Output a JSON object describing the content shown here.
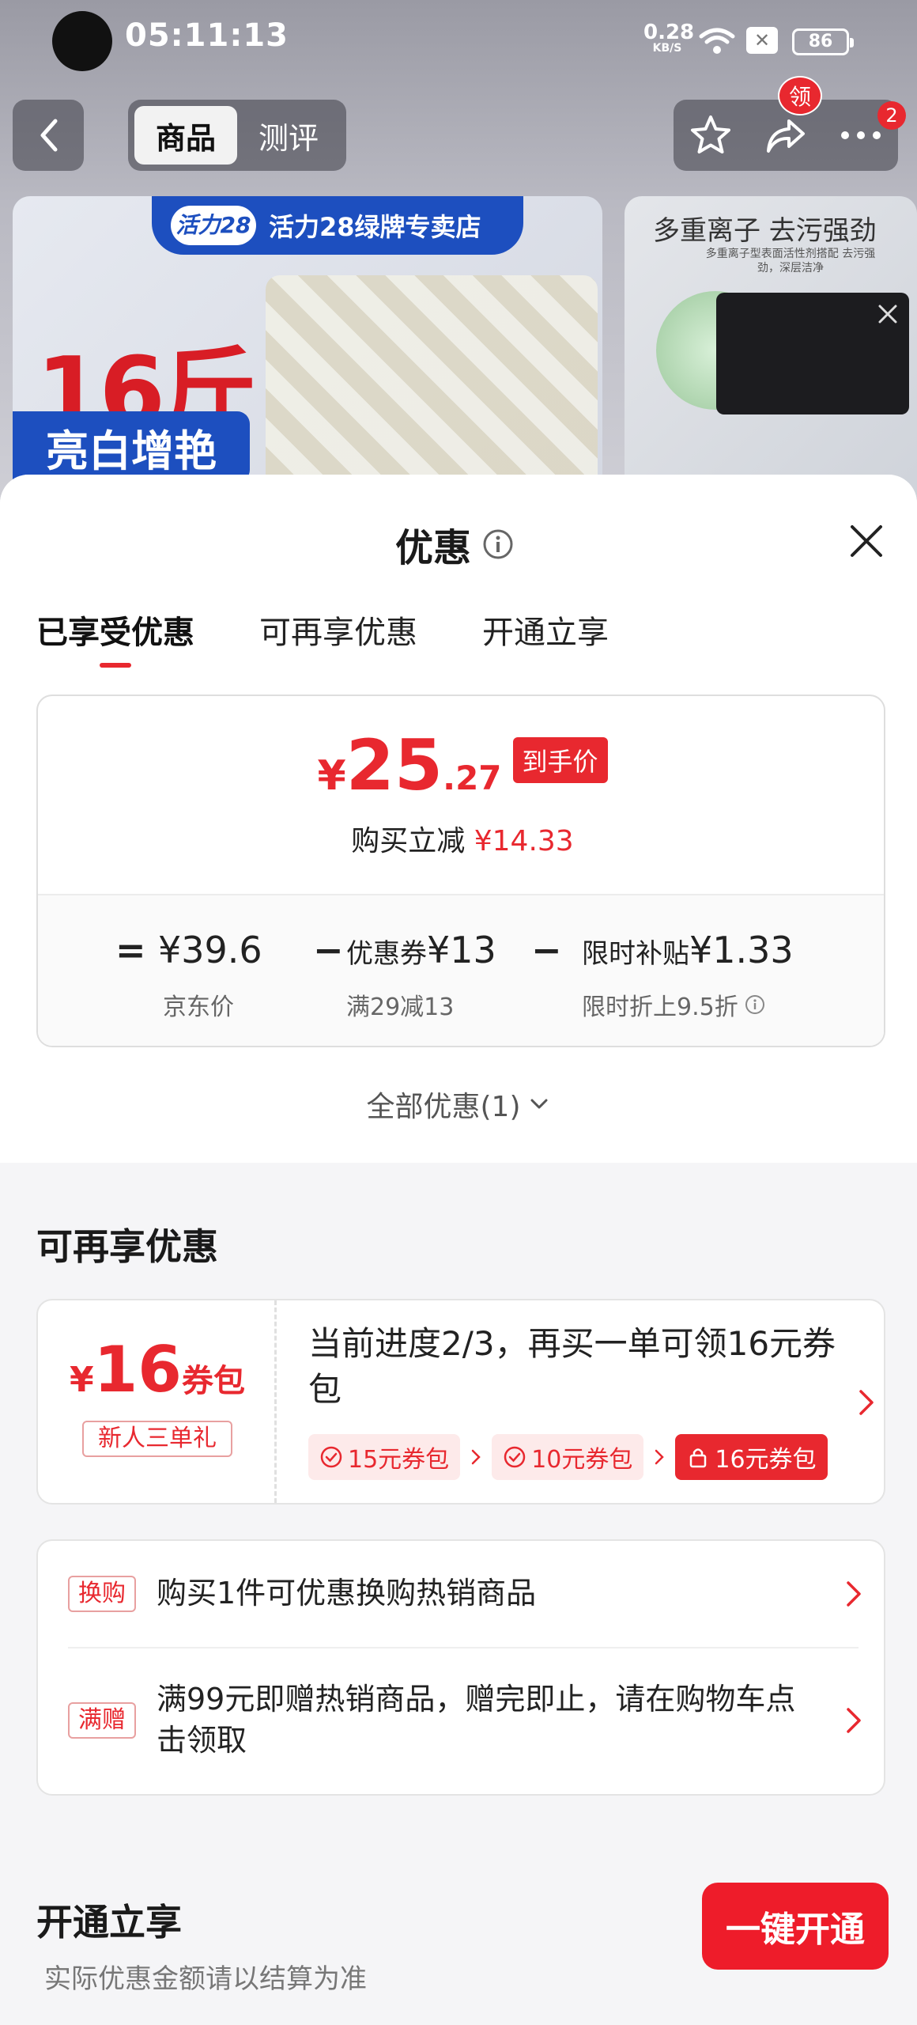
{
  "status_bar": {
    "time": "05:11:13",
    "net_speed_value": "0.28",
    "net_speed_unit": "KB/S",
    "battery": "86"
  },
  "top_nav": {
    "tabs": [
      {
        "label": "商品",
        "active": true
      },
      {
        "label": "测评",
        "active": false
      }
    ],
    "ling_badge": "领",
    "more_badge": "2"
  },
  "product": {
    "store_logo": "活力28",
    "store_name": "活力28绿牌专卖店",
    "weight": "16斤",
    "slogan": "亮白增艳",
    "side_title": "多重离子 去污强劲",
    "side_subtitle": "多重离子型表面活性剂搭配 去污强劲，深层洁净"
  },
  "sheet": {
    "title": "优惠",
    "tabs": [
      {
        "label": "已享受优惠",
        "active": true
      },
      {
        "label": "可再享优惠",
        "active": false
      },
      {
        "label": "开通立享",
        "active": false
      }
    ],
    "price": {
      "currency": "¥",
      "integer": "25",
      "decimal": ".27",
      "tag": "到手价",
      "save_label": "购买立减",
      "save_amount": "¥14.33"
    },
    "formula": {
      "equals": "=",
      "minus": "−",
      "terms": [
        {
          "prefix": "",
          "value": "¥39.6",
          "label": "京东价"
        },
        {
          "prefix": "优惠券",
          "value": "¥13",
          "label": "满29减13"
        },
        {
          "prefix": "限时补贴",
          "value": "¥1.33",
          "label": "限时折上9.5折"
        }
      ]
    },
    "all_offers": "全部优惠(1)",
    "more_section_title": "可再享优惠",
    "coupon": {
      "currency": "¥",
      "amount": "16",
      "unit": "券包",
      "label": "新人三单礼",
      "description": "当前进度2/3，再买一单可领16元券包",
      "steps": [
        {
          "label": "15元券包",
          "state": "done"
        },
        {
          "label": "10元券包",
          "state": "done"
        },
        {
          "label": "16元券包",
          "state": "locked"
        }
      ]
    },
    "gifts": [
      {
        "tag": "换购",
        "text": "购买1件可优惠换购热销商品"
      },
      {
        "tag": "满赠",
        "text": "满99元即赠热销商品，赠完即止，请在购物车点击领取"
      }
    ],
    "open_section": {
      "title": "开通立享",
      "note": "实际优惠金额请以结算为准",
      "button": "一键开通"
    }
  },
  "colors": {
    "accent_red": "#e8282f",
    "button_red": "#ee1c2a",
    "store_blue": "#1d4fbf"
  }
}
